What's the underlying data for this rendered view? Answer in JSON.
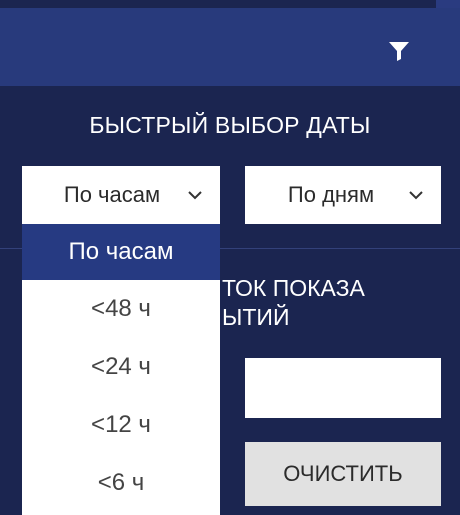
{
  "header": {
    "filter_icon": "filter-icon"
  },
  "quick_date": {
    "title": "БЫСТРЫЙ ВЫБОР ДАТЫ",
    "hours_select": {
      "value": "По часам"
    },
    "days_select": {
      "value": "По дням"
    },
    "hours_options": [
      "По часам",
      "<48 ч",
      "<24 ч",
      "<12 ч",
      "<6 ч"
    ]
  },
  "display_period": {
    "title_partial": "ТОК ПОКАЗА\nЫТИЙ",
    "clear_label": "ОЧИСТИТЬ"
  },
  "colors": {
    "background": "#1b2550",
    "header": "#283a7c",
    "selected_option": "#263a82",
    "button_gray": "#e1e1e1"
  }
}
